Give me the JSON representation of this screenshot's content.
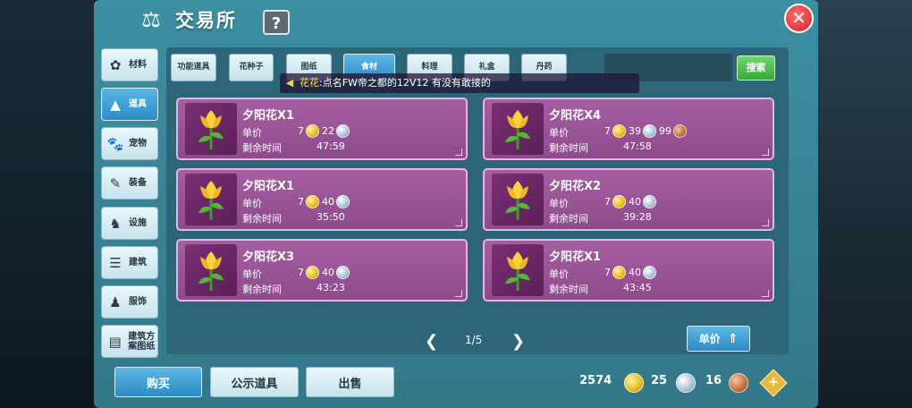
{
  "header": {
    "title": "交易所",
    "help": "?",
    "close": "✕"
  },
  "sidebar": [
    {
      "label": "材料",
      "icon": "✿"
    },
    {
      "label": "道具",
      "icon": "▲",
      "active": true
    },
    {
      "label": "宠物",
      "icon": "🐾"
    },
    {
      "label": "装备",
      "icon": "✎"
    },
    {
      "label": "设施",
      "icon": "♞"
    },
    {
      "label": "建筑",
      "icon": "☰"
    },
    {
      "label": "服饰",
      "icon": "♟"
    },
    {
      "label": "建筑方案图纸",
      "icon": "▤"
    }
  ],
  "tabs": [
    {
      "label": "功能道具"
    },
    {
      "label": "花种子"
    },
    {
      "label": "图纸"
    },
    {
      "label": "食材",
      "active": true
    },
    {
      "label": "料理"
    },
    {
      "label": "礼盒"
    },
    {
      "label": "丹药"
    }
  ],
  "search": {
    "button": "搜索"
  },
  "broadcast": {
    "sender": "花花",
    "message": ":点名FW帝之都的12V12  有没有敢接的"
  },
  "listing_labels": {
    "price": "单价",
    "time_left": "剩余时间"
  },
  "listings": [
    {
      "name": "夕阳花X1",
      "gold": "7",
      "silver": "22",
      "bronze": null,
      "time": "47:59"
    },
    {
      "name": "夕阳花X4",
      "gold": "7",
      "silver": "39",
      "bronze": "99",
      "time": "47:58"
    },
    {
      "name": "夕阳花X1",
      "gold": "7",
      "silver": "40",
      "bronze": null,
      "time": "35:50"
    },
    {
      "name": "夕阳花X2",
      "gold": "7",
      "silver": "40",
      "bronze": null,
      "time": "39:28"
    },
    {
      "name": "夕阳花X3",
      "gold": "7",
      "silver": "40",
      "bronze": null,
      "time": "43:23"
    },
    {
      "name": "夕阳花X1",
      "gold": "7",
      "silver": "40",
      "bronze": null,
      "time": "43:45"
    }
  ],
  "pager": {
    "prev": "❮",
    "text": "1/5",
    "next": "❯"
  },
  "sort": {
    "label": "单价"
  },
  "footer": {
    "buy": "购买",
    "public": "公示道具",
    "sell": "出售",
    "gold": "2574",
    "silver": "25",
    "bronze": "16",
    "plus": "+"
  },
  "colors": {
    "panel": "#3a8599",
    "card": "#9a5597",
    "accent_blue": "#2e8ac6",
    "search_green": "#38a73c",
    "close_red": "#d42424"
  }
}
